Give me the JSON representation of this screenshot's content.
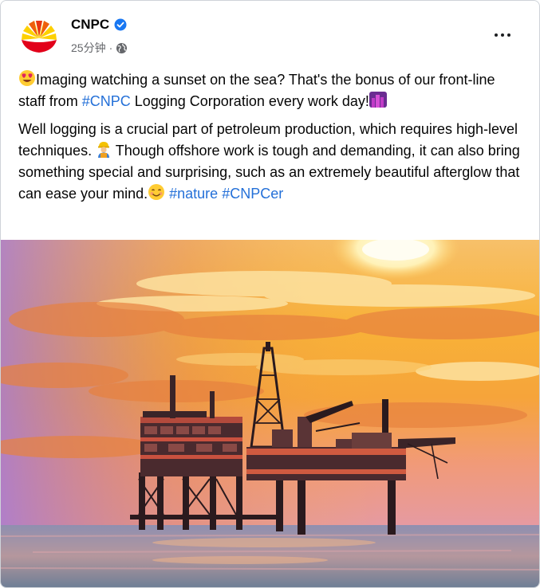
{
  "post": {
    "author": "CNPC",
    "time": "25分钟",
    "separator": "·",
    "audience_icon": "globe-icon",
    "verified_icon": "verified-badge-icon",
    "more_icon": "more-options-icon",
    "paragraph1": {
      "text_a": "Imaging watching a sunset on the sea? That's the bonus of our front-line staff from ",
      "hashtag": "#CNPC",
      "text_b": " Logging Corporation every work day!"
    },
    "paragraph2": {
      "text_a": "Well logging is a crucial part of petroleum production, which requires high-level techniques.",
      "text_b": " Though offshore work is tough and demanding, it can also bring something special and surprising, such as an extremely beautiful afterglow that can ease your mind.",
      "hashtag_1": "#nature",
      "hashtag_2": "#CNPCer"
    },
    "emojis": [
      "heart-eyes-emoji",
      "night-city-emoji",
      "construction-worker-emoji",
      "smiling-face-emoji"
    ],
    "image": "offshore-oil-platform-sunset-photo"
  },
  "colors": {
    "hashtag": "#2470d8",
    "verified": "#1877f2",
    "logo_red": "#e2001a",
    "logo_yellow": "#fdd000"
  }
}
